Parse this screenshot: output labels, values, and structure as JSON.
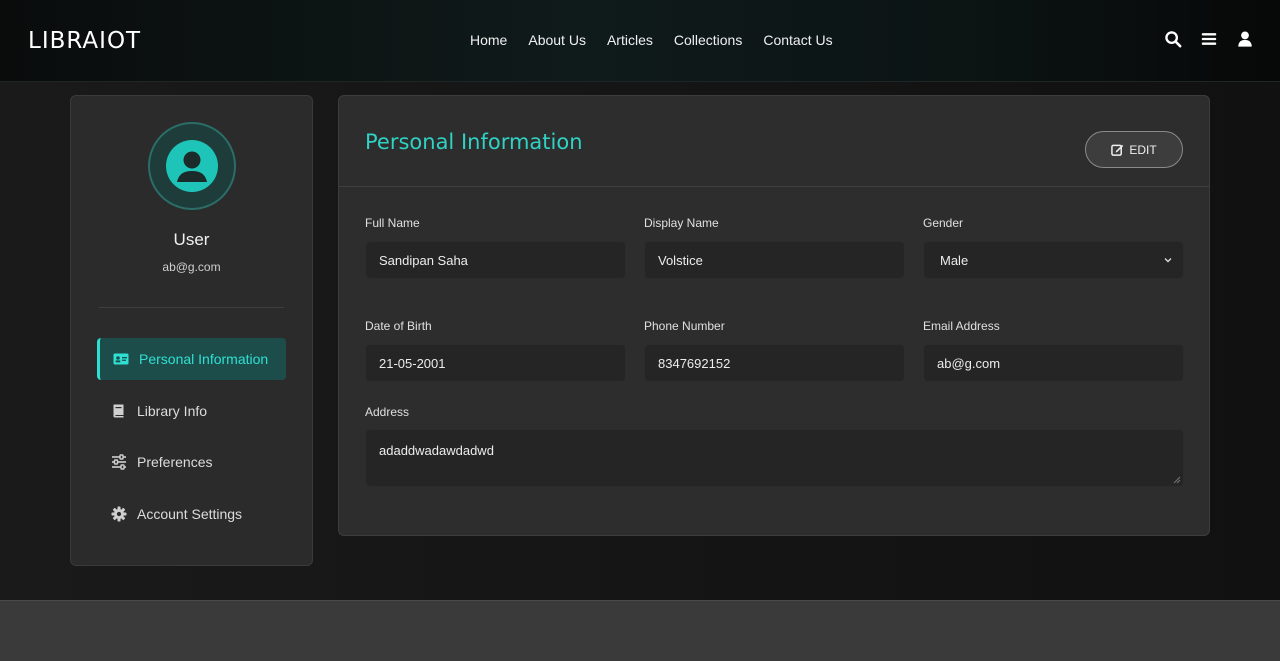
{
  "brand": "LIBRAIOT",
  "nav": {
    "links": [
      "Home",
      "About Us",
      "Articles",
      "Collections",
      "Contact Us"
    ],
    "icons": [
      "search-icon",
      "menu-icon",
      "user-icon"
    ]
  },
  "profile": {
    "name": "User",
    "email": "ab@g.com"
  },
  "sidebar": {
    "items": [
      {
        "label": "Personal Information",
        "icon": "id-card-icon",
        "active": true
      },
      {
        "label": "Library Info",
        "icon": "book-icon",
        "active": false
      },
      {
        "label": "Preferences",
        "icon": "sliders-icon",
        "active": false
      },
      {
        "label": "Account Settings",
        "icon": "gear-icon",
        "active": false
      }
    ]
  },
  "card": {
    "title": "Personal Information",
    "edit_label": "EDIT",
    "fields": {
      "full_name": {
        "label": "Full Name",
        "value": "Sandipan Saha"
      },
      "display_name": {
        "label": "Display Name",
        "value": "Volstice"
      },
      "gender": {
        "label": "Gender",
        "value": "Male"
      },
      "dob": {
        "label": "Date of Birth",
        "value": "21-05-2001"
      },
      "phone": {
        "label": "Phone Number",
        "value": "8347692152"
      },
      "email": {
        "label": "Email Address",
        "value": "ab@g.com"
      },
      "address": {
        "label": "Address",
        "value": "adaddwadawdadwd"
      }
    }
  },
  "colors": {
    "accent": "#2fd2c4",
    "active_bg": "#1c4d4b",
    "card_bg": "#2d2d2d",
    "input_bg": "#252525"
  }
}
